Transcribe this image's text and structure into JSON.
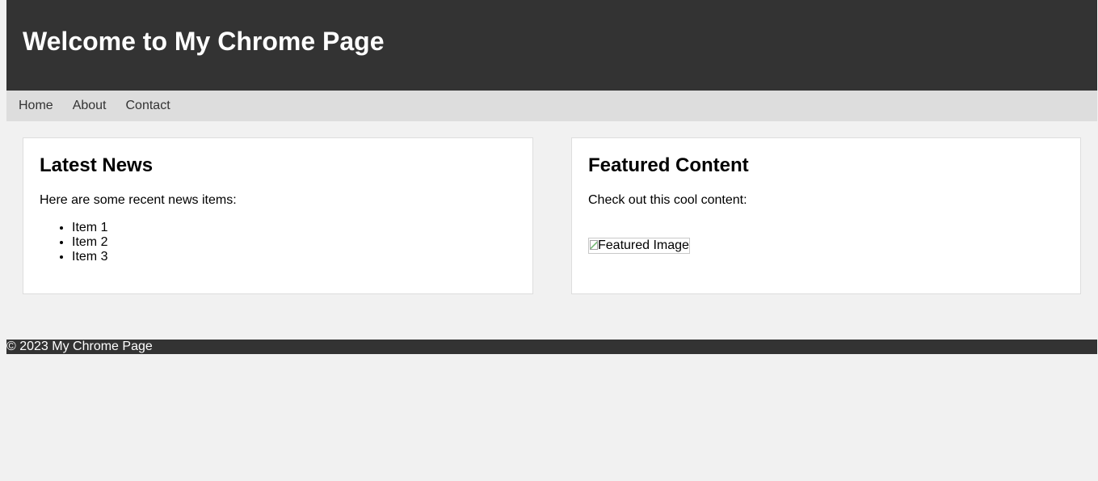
{
  "header": {
    "title": "Welcome to My Chrome Page"
  },
  "nav": {
    "items": [
      {
        "label": "Home"
      },
      {
        "label": "About"
      },
      {
        "label": "Contact"
      }
    ]
  },
  "news": {
    "title": "Latest News",
    "intro": "Here are some recent news items:",
    "items": [
      "Item 1",
      "Item 2",
      "Item 3"
    ]
  },
  "featured": {
    "title": "Featured Content",
    "intro": "Check out this cool content:",
    "image_alt": "Featured Image",
    "image_icon": "broken-image-icon"
  },
  "footer": {
    "text": "© 2023 My Chrome Page"
  },
  "colors": {
    "header_bg": "#333333",
    "nav_bg": "#dddddd",
    "page_bg": "#f1f1f1",
    "card_bg": "#ffffff",
    "card_border": "#dddddd"
  }
}
